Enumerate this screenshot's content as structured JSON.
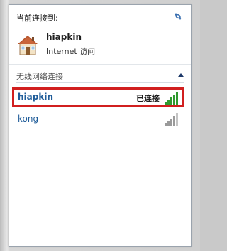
{
  "current": {
    "label": "当前连接到:",
    "network_name": "hiapkin",
    "network_status": "Internet 访问"
  },
  "section": {
    "title": "无线网络连接"
  },
  "networks": [
    {
      "name": "hiapkin",
      "state": "已连接",
      "signal": "strong",
      "signal_color": "#2f9a2f"
    },
    {
      "name": "kong",
      "state": "",
      "signal": "partial",
      "signal_color": "#9a9a9a"
    }
  ],
  "colors": {
    "highlight_border": "#d11f1f",
    "link_blue": "#1f5c99"
  },
  "icons": {
    "refresh": "refresh-icon",
    "home": "house-icon",
    "collapse": "chevron-up-icon",
    "signal": "signal-bars-icon"
  }
}
